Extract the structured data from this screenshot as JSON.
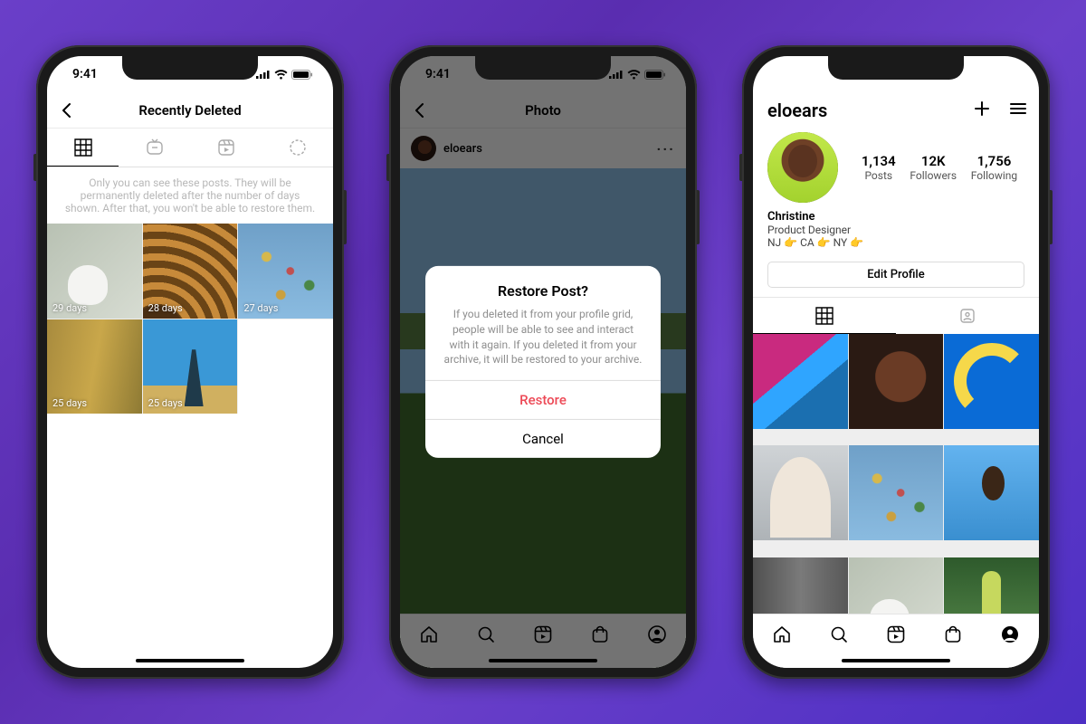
{
  "status": {
    "time": "9:41"
  },
  "phone1": {
    "title": "Recently Deleted",
    "info": "Only you can see these posts. They will be permanently deleted after the number of days shown. After that, you won't be able to restore them.",
    "tabs": [
      "grid",
      "igtv",
      "reels",
      "highlights"
    ],
    "thumbs": [
      {
        "label": "29 days"
      },
      {
        "label": "28 days"
      },
      {
        "label": "27 days"
      },
      {
        "label": "25 days"
      },
      {
        "label": "25 days"
      }
    ]
  },
  "phone2": {
    "title": "Photo",
    "user": "eloears",
    "dialog": {
      "title": "Restore Post?",
      "message": "If you deleted it from your profile grid, people will be able to see and interact with it again. If you deleted it from your archive, it will be restored to your archive.",
      "primary": "Restore",
      "cancel": "Cancel"
    }
  },
  "phone3": {
    "username": "eloears",
    "stats": [
      {
        "n": "1,134",
        "l": "Posts"
      },
      {
        "n": "12K",
        "l": "Followers"
      },
      {
        "n": "1,756",
        "l": "Following"
      }
    ],
    "bio": {
      "name": "Christine",
      "role": "Product Designer",
      "loc": "NJ 👉 CA 👉 NY 👉"
    },
    "edit": "Edit Profile"
  }
}
